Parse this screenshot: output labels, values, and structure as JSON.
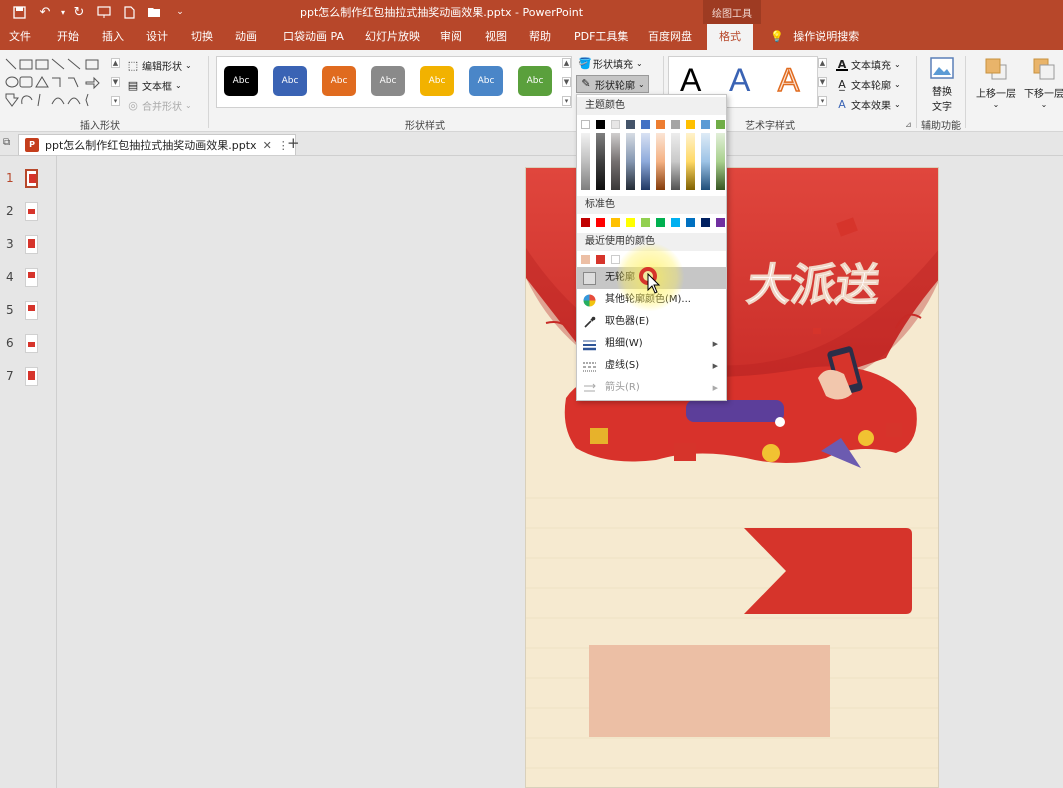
{
  "titlebar": {
    "title": "ppt怎么制作红包抽拉式抽奖动画效果.pptx  -  PowerPoint",
    "context_tab": "绘图工具"
  },
  "tabs": [
    "文件",
    "开始",
    "插入",
    "设计",
    "切换",
    "动画",
    "口袋动画 PA",
    "幻灯片放映",
    "审阅",
    "视图",
    "帮助",
    "PDF工具集",
    "百度网盘",
    "格式"
  ],
  "tell_me": "操作说明搜索",
  "ribbon": {
    "insert_shapes": {
      "label": "插入形状",
      "edit_shape": "编辑形状",
      "text_box": "文本框",
      "merge_shapes": "合并形状"
    },
    "shape_styles": {
      "label": "形状样式",
      "sample_text": "Abc",
      "swatches": [
        "#000000",
        "#3a63b4",
        "#e06b1f",
        "#8a8a8a",
        "#f2b200",
        "#4a86c8",
        "#5aa03c"
      ],
      "fill": "形状填充",
      "outline": "形状轮廓"
    },
    "wordart": {
      "label": "艺术字样式",
      "letter": "A",
      "text_fill": "文本填充",
      "text_outline": "文本轮廓",
      "text_effect": "文本效果"
    },
    "accessibility": {
      "label": "辅助功能",
      "alt_text_line1": "替换",
      "alt_text_line2": "文字"
    },
    "arrange": {
      "bring_forward": "上移一层",
      "send_backward": "下移一层"
    }
  },
  "doc_tab": {
    "name": "ppt怎么制作红包抽拉式抽奖动画效果.pptx"
  },
  "thumbnails": [
    "1",
    "2",
    "3",
    "4",
    "5",
    "6",
    "7"
  ],
  "slide": {
    "headline": "大派送"
  },
  "outline_menu": {
    "theme_colors_label": "主题颜色",
    "theme_top_row": [
      "#ffffff",
      "#000000",
      "#e7e6e6",
      "#44546a",
      "#4472c4",
      "#ed7d31",
      "#a5a5a5",
      "#ffc000",
      "#5b9bd5",
      "#70ad47"
    ],
    "standard_colors_label": "标准色",
    "standard_colors": [
      "#c00000",
      "#ff0000",
      "#ffc000",
      "#ffff00",
      "#92d050",
      "#00b050",
      "#00b0f0",
      "#0070c0",
      "#002060",
      "#7030a0"
    ],
    "recent_colors_label": "最近使用的颜色",
    "recent_colors": [
      "#ecbfa5",
      "#d6342b",
      "#ffffff"
    ],
    "no_outline": "无轮廓",
    "more_colors": "其他轮廓颜色(M)...",
    "eyedropper": "取色器(E)",
    "weight": "粗细(W)",
    "dashes": "虚线(S)",
    "arrows": "箭头(R)"
  }
}
